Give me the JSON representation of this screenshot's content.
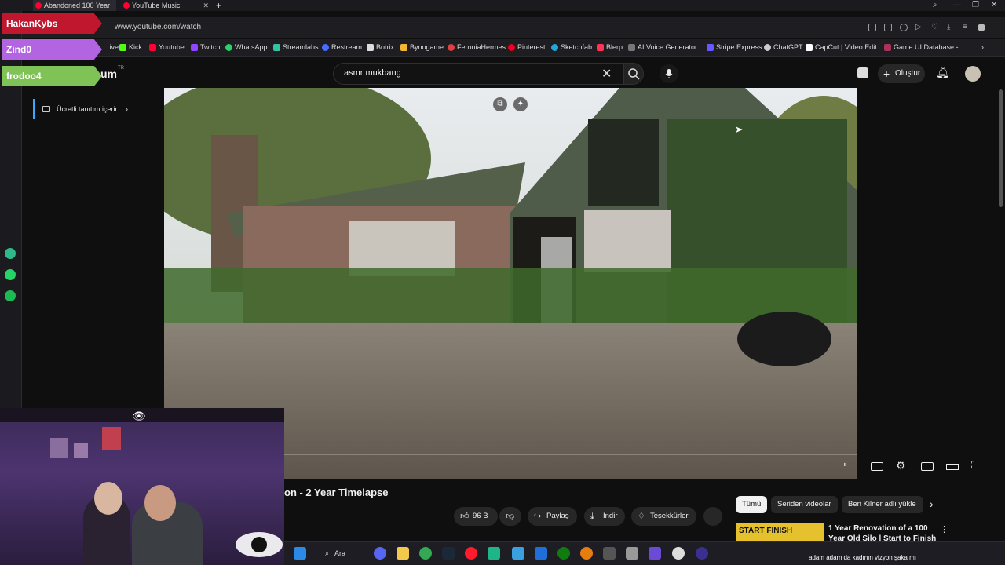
{
  "browser": {
    "tabs": [
      {
        "label": "Abandoned 100 Year",
        "active": true
      },
      {
        "label": "YouTube Music",
        "active": false
      }
    ],
    "url": "www.youtube.com/watch",
    "bookmarks": [
      "...ive",
      "Kick",
      "Youtube",
      "Twitch",
      "WhatsApp",
      "Streamlabs",
      "Restream",
      "Botrix",
      "Bynogame",
      "FeroniaHermes",
      "Pinterest",
      "Sketchfab",
      "Blerp",
      "AI Voice Generator...",
      "Stripe Express",
      "ChatGPT",
      "CapCut | Video Edit...",
      "Game UI Database -..."
    ]
  },
  "overlay_tags": [
    "HakanKybs",
    "Zind0",
    "frodoo4"
  ],
  "youtube": {
    "logo_suffix": "um",
    "country_code": "TR",
    "search_value": "asmr mukbang",
    "create_label": "Oluştur",
    "promo_label": "Ücretli tanıtım içerir",
    "video_title": "on - 2 Year Timelapse",
    "actions": {
      "likes": "96 B",
      "share": "Paylaş",
      "download": "İndir",
      "thanks": "Teşekkürler"
    },
    "chips": [
      "Tümü",
      "Seriden videolar",
      "Ben Kilner adlı yükle"
    ],
    "related": {
      "thumb_text": "START FINISH",
      "title": "1 Year Renovation of a 100 Year Old Silo | Start to Finish"
    }
  },
  "taskbar": {
    "search_label": "Ara",
    "ticker": "adam adam da kadının vizyon şaka mı"
  },
  "colors": {
    "bg": "#0f0f0f",
    "accent": "#3ea6ff",
    "tag_red": "#c0172e",
    "tag_purple": "#b364e0",
    "tag_green": "#7fc255"
  }
}
